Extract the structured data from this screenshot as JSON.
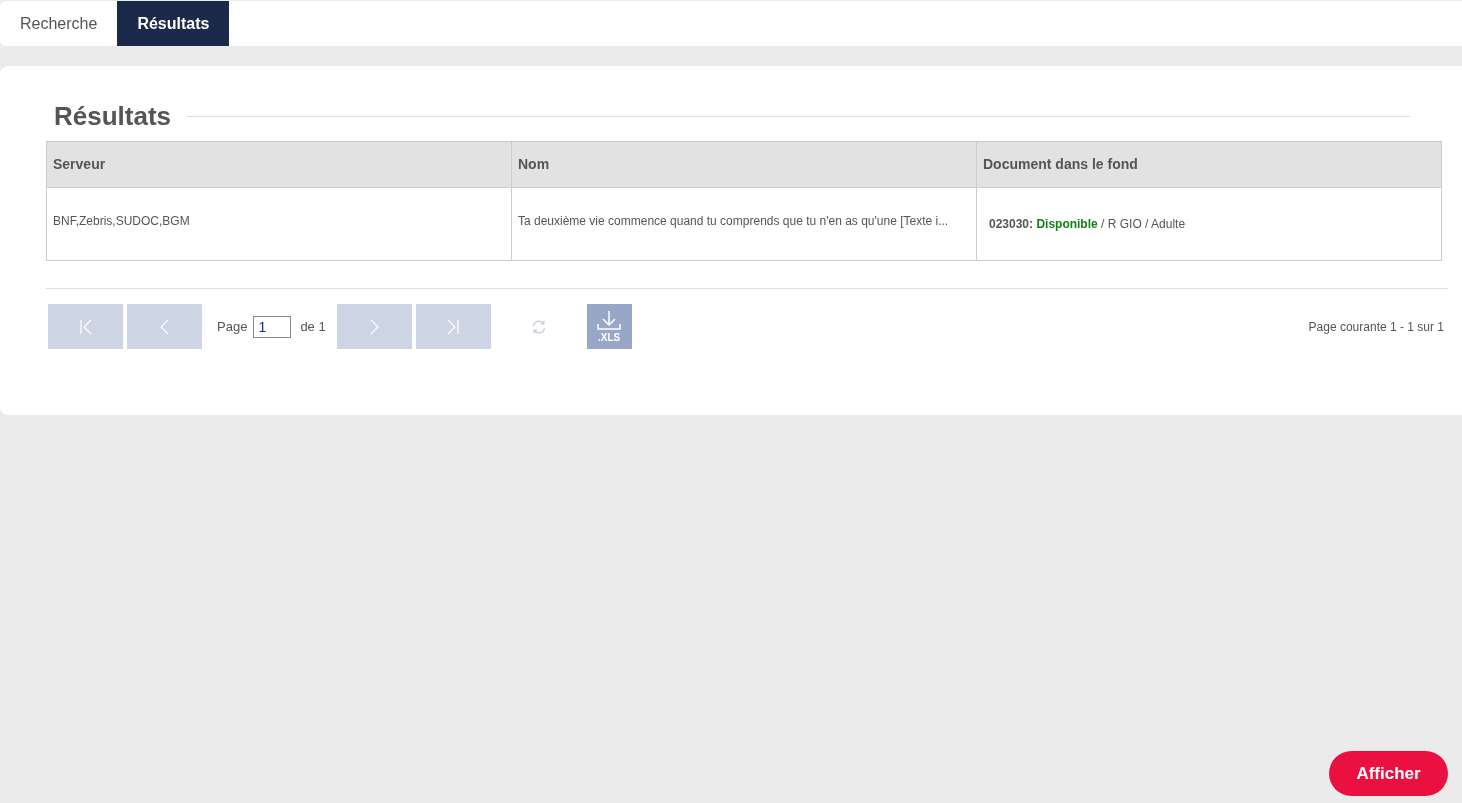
{
  "tabs": [
    {
      "label": "Recherche",
      "selected": false
    },
    {
      "label": "Résultats",
      "selected": true
    }
  ],
  "panel": {
    "title": "Résultats"
  },
  "table": {
    "columns": [
      "Serveur",
      "Nom",
      "Document dans le fond"
    ],
    "rows": [
      {
        "serveur": "BNF,Zebris,SUDOC,BGM",
        "nom": "Ta deuxième vie commence quand tu comprends que tu n'en as qu'une [Texte i...",
        "document": {
          "code": "023030:",
          "status": "Disponible",
          "color": "#15801a",
          "details": "/ R GIO / Adulte"
        }
      }
    ]
  },
  "pager": {
    "first": {
      "kind": "first",
      "disabled": true
    },
    "prev": {
      "kind": "prev",
      "disabled": true
    },
    "page_label": "Page",
    "page_value": "1",
    "of_label": "de 1",
    "next": {
      "kind": "next",
      "disabled": true
    },
    "last": {
      "kind": "last",
      "disabled": true
    },
    "export_label": ".XLS",
    "summary": "Page courante 1 - 1 sur 1"
  },
  "action_button": "Afficher"
}
